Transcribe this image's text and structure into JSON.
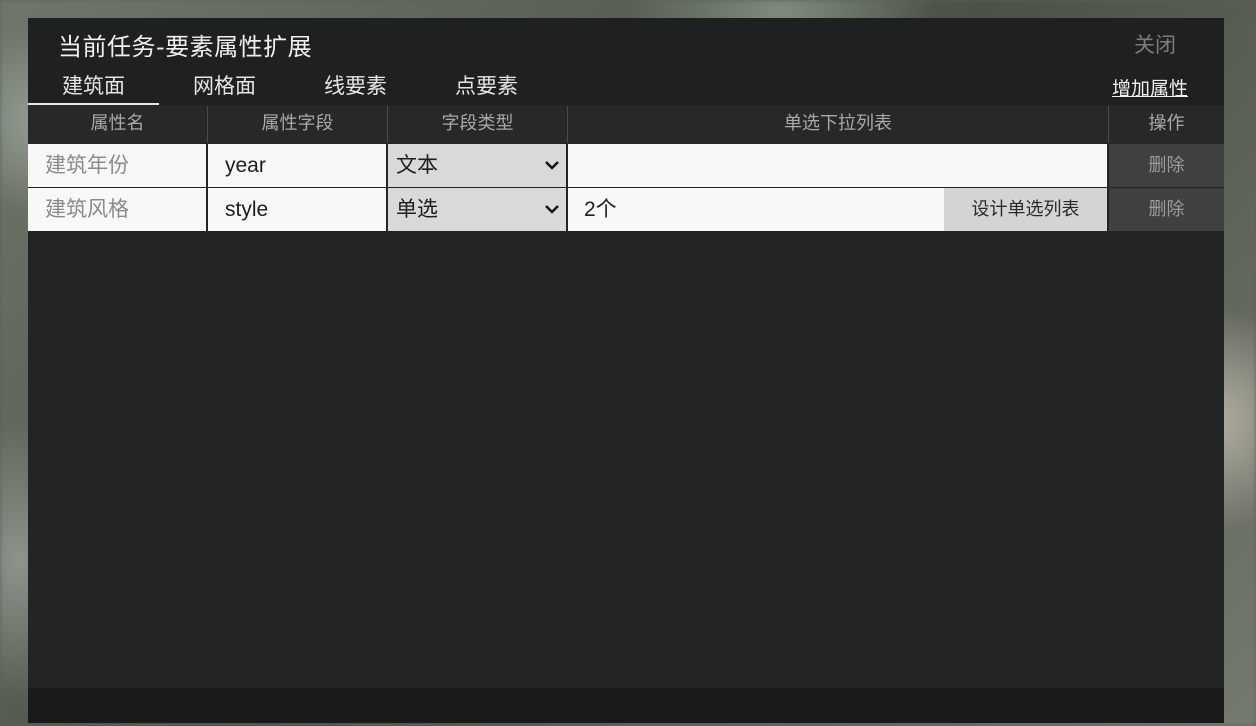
{
  "dialog": {
    "title": "当前任务-要素属性扩展",
    "close_label": "关闭"
  },
  "tabs": [
    {
      "label": "建筑面",
      "active": true
    },
    {
      "label": "网格面",
      "active": false
    },
    {
      "label": "线要素",
      "active": false
    },
    {
      "label": "点要素",
      "active": false
    }
  ],
  "add_attribute_label": "增加属性",
  "table": {
    "headers": [
      "属性名",
      "属性字段",
      "字段类型",
      "单选下拉列表",
      "操作"
    ],
    "rows": [
      {
        "name": "建筑年份",
        "field": "year",
        "type": "文本",
        "options_value": "",
        "design_label": "",
        "action": "删除"
      },
      {
        "name": "建筑风格",
        "field": "style",
        "type": "单选",
        "options_value": "2个",
        "design_label": "设计单选列表",
        "action": "删除"
      }
    ]
  },
  "colors": {
    "dialog_bg": "#232425",
    "title_bar_bg": "#1f2021",
    "select_bg": "#d9d9d9",
    "action_bg": "#3f4042"
  }
}
